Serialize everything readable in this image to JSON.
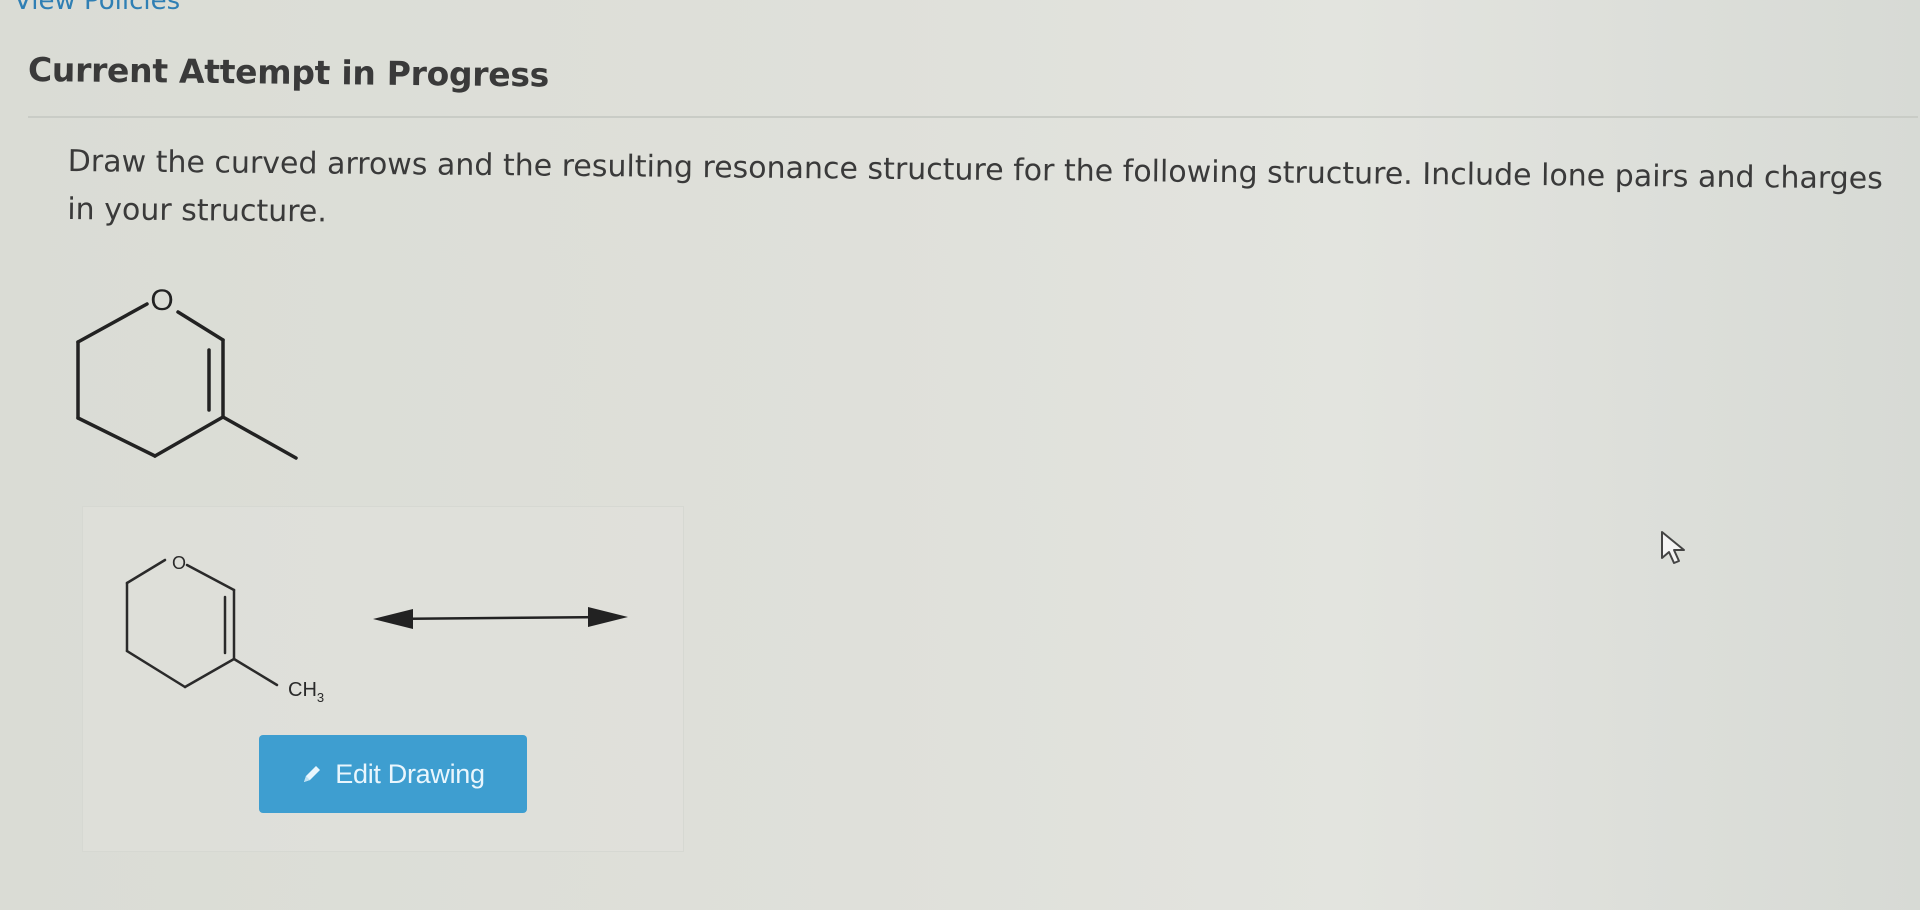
{
  "nav": {
    "policies_link": "View Policies"
  },
  "header": {
    "title": "Current Attempt in Progress"
  },
  "question": {
    "prompt": "Draw the curved arrows and the resulting resonance structure for the following structure. Include lone pairs and charges in your structure."
  },
  "structure": {
    "oxygen_label": "O"
  },
  "answer": {
    "oxygen_label": "O",
    "methyl_label": "CH",
    "methyl_subscript": "3",
    "resonance_arrow": "double-headed-arrow-icon"
  },
  "toolbar": {
    "edit_label": "Edit Drawing",
    "edit_icon": "pencil-icon"
  },
  "colors": {
    "link": "#2f7fb4",
    "button": "#3e9ed0",
    "text": "#3a3a3a"
  }
}
